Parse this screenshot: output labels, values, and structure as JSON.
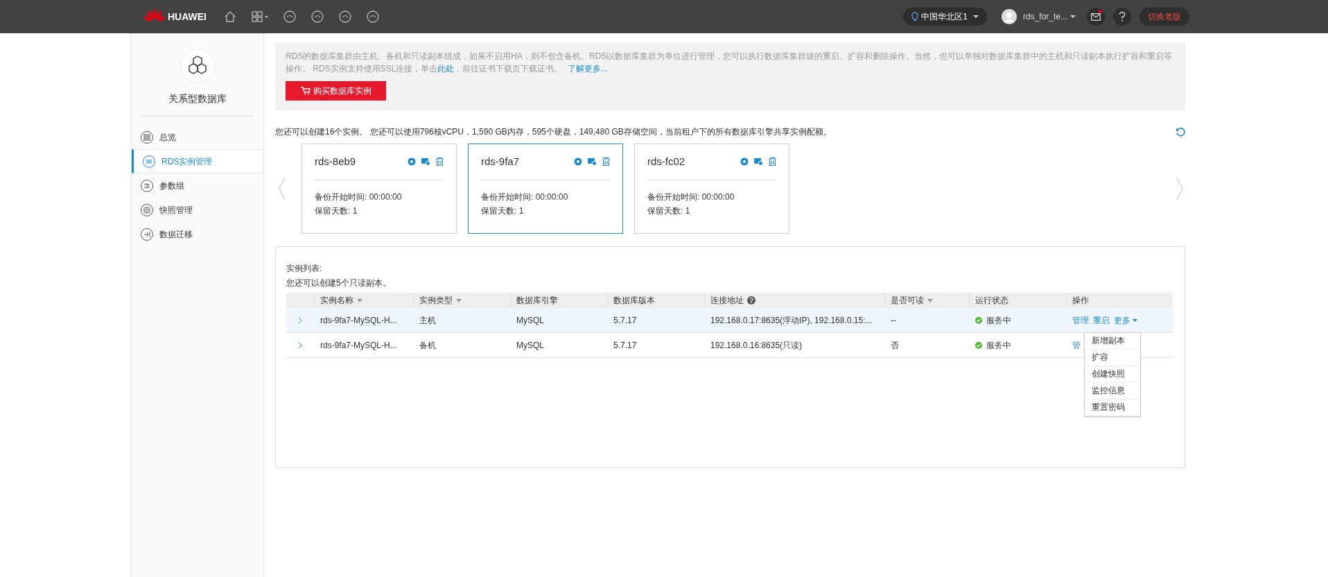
{
  "topbar": {
    "brand": "HUAWEI",
    "region": "中国华北区1",
    "user": "rds_for_te...",
    "mail_unread": true,
    "old_version": "切换老版"
  },
  "sidebar": {
    "title": "关系型数据库",
    "items": [
      {
        "label": "总览",
        "selected": false
      },
      {
        "label": "RDS实例管理",
        "selected": true
      },
      {
        "label": "参数组",
        "selected": false
      },
      {
        "label": "快照管理",
        "selected": false
      },
      {
        "label": "数据迁移",
        "selected": false
      }
    ]
  },
  "notice": {
    "text": "RDS的数据库集群由主机、备机和只读副本组成，如果不启用HA，则不包含备机。RDS以数据库集群为单位进行管理，您可以执行数据库集群级的重启、扩容和删除操作。当然，也可以单独对数据库集群中的主机和只读副本执行扩容和重启等操作。 RDS实例支持使用SSL连接，单击",
    "link": "此处",
    "text_after": "，前往证书下载页下载证书。",
    "more": "了解更多...",
    "buy_button": "购买数据库实例"
  },
  "quota": "您还可以创建16个实例。 您还可以使用796核vCPU，1,590 GB内存，595个硬盘，149,480 GB存储空间，当前租户下的所有数据库引擎共享实例配额。",
  "clusters": [
    {
      "name": "rds-8eb9",
      "backup": "备份开始时间: 00:00:00",
      "retention": "保留天数: 1",
      "selected": false
    },
    {
      "name": "rds-9fa7",
      "backup": "备份开始时间: 00:00:00",
      "retention": "保留天数: 1",
      "selected": true
    },
    {
      "name": "rds-fc02",
      "backup": "备份开始时间: 00:00:00",
      "retention": "保留天数: 1",
      "selected": false
    }
  ],
  "instances": {
    "title": "实例列表:",
    "subtitle": "您还可以创建5个只读副本。",
    "columns": [
      {
        "label": "实例名称",
        "sortable": true
      },
      {
        "label": "实例类型",
        "sortable": true
      },
      {
        "label": "数据库引擎",
        "sortable": false
      },
      {
        "label": "数据库版本",
        "sortable": false
      },
      {
        "label": "连接地址",
        "help": true
      },
      {
        "label": "是否可读",
        "sortable": true
      },
      {
        "label": "运行状态",
        "sortable": false
      },
      {
        "label": "操作",
        "sortable": false
      }
    ],
    "rows": [
      {
        "name": "rds-9fa7-MySQL-H...",
        "type": "主机",
        "engine": "MySQL",
        "version": "5.7.17",
        "address": "192.168.0.17:8635(浮动IP), 192.168.0.15:...",
        "readable": "--",
        "status": "服务中",
        "actions": [
          "管理",
          "重启",
          "更多"
        ],
        "selected": true
      },
      {
        "name": "rds-9fa7-MySQL-H...",
        "type": "备机",
        "engine": "MySQL",
        "version": "5.7.17",
        "address": "192.168.0.16:8635(只读)",
        "readable": "否",
        "status": "服务中",
        "actions": [
          "管"
        ],
        "selected": false
      }
    ],
    "menu": [
      "新增副本",
      "扩容",
      "创建快照",
      "监控信息",
      "重置密码"
    ]
  }
}
